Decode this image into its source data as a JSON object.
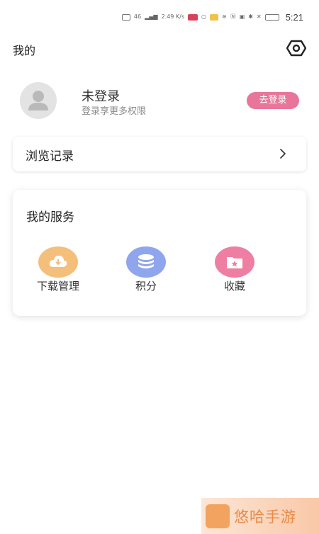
{
  "status_bar": {
    "net_label": "46",
    "speed_label": "2.49 K/s",
    "time": "5:21"
  },
  "header": {
    "title": "我的"
  },
  "profile": {
    "username": "未登录",
    "hint": "登录享更多权限",
    "login_button": "去登录"
  },
  "history": {
    "label": "浏览记录"
  },
  "services": {
    "title": "我的服务",
    "items": [
      {
        "label": "下载管理",
        "icon": "cloud-download-icon",
        "color": "#f4bf7a"
      },
      {
        "label": "积分",
        "icon": "coin-stack-icon",
        "color": "#8fa6ee"
      },
      {
        "label": "收藏",
        "icon": "star-folder-icon",
        "color": "#ee7fa2"
      }
    ]
  },
  "watermark": {
    "text": "悠哈手游"
  },
  "colors": {
    "accent_pink": "#e8769a",
    "background": "#ffffff"
  }
}
